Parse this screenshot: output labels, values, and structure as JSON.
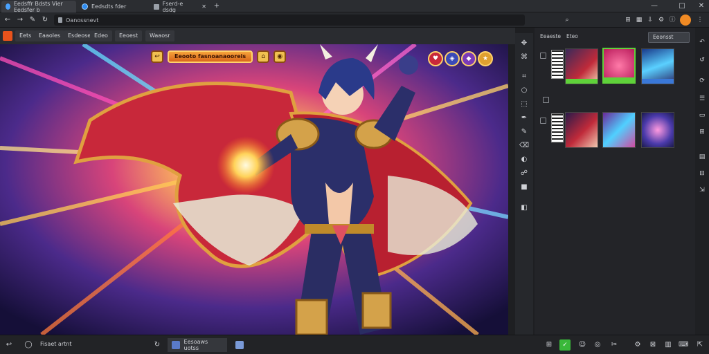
{
  "titlebar": {
    "tabs": [
      {
        "label": "Eedsffr Bdsts Vier Eedsfer b"
      },
      {
        "label": "Eedsdts fder"
      },
      {
        "label": "Fserd-e dsdg"
      }
    ],
    "new_tab": "+",
    "controls": {
      "minimize": "—",
      "maximize": "□",
      "close": "✕"
    }
  },
  "navbar": {
    "url": "Oanossnevt"
  },
  "menubar": {
    "items": [
      {
        "label": "Eets"
      },
      {
        "label": "Eaaoles"
      },
      {
        "label": "Esdeoses"
      },
      {
        "label": "Edeo"
      },
      {
        "label": "Eeoest"
      },
      {
        "label": "Waaosr"
      }
    ]
  },
  "hud": {
    "title": "Eeooto fasnoanaooreis"
  },
  "panel": {
    "tabs": [
      {
        "label": "Eeaeste"
      },
      {
        "label": "Eteo"
      }
    ],
    "button": "Eeonsst"
  },
  "statusbar": {
    "left_label": "Fisaet artnt",
    "tab_label": "Eesoaws uotss"
  },
  "colors": {
    "accent": "#f08a24",
    "selected_thumb": "#5fd13a",
    "thumb_blue": "#3a78d8"
  }
}
